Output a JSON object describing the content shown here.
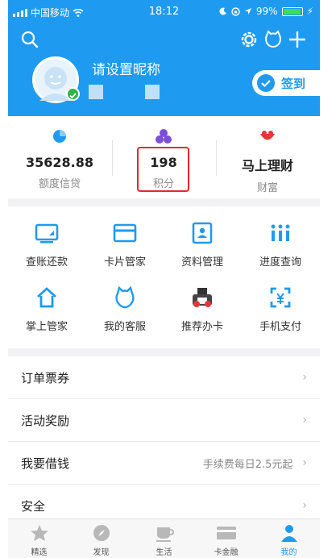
{
  "status_bar": {
    "carrier": "中国移动",
    "time": "18:12",
    "battery": "99%"
  },
  "profile": {
    "nickname": "请设置昵称",
    "signin_label": "签到"
  },
  "stats": [
    {
      "value": "35628.88",
      "label": "额度信贷"
    },
    {
      "value": "198",
      "label": "积分"
    },
    {
      "value": "马上理财",
      "label": "财富"
    }
  ],
  "grid": [
    {
      "label": "查账还款",
      "icon": "bill-icon"
    },
    {
      "label": "卡片管家",
      "icon": "card-icon"
    },
    {
      "label": "资料管理",
      "icon": "profile-doc-icon"
    },
    {
      "label": "进度查询",
      "icon": "progress-icon"
    },
    {
      "label": "掌上管家",
      "icon": "home-icon"
    },
    {
      "label": "我的客服",
      "icon": "customer-service-icon"
    },
    {
      "label": "推荐办卡",
      "icon": "recommend-card-icon"
    },
    {
      "label": "手机支付",
      "icon": "scan-pay-icon"
    }
  ],
  "list": [
    {
      "label": "订单票券",
      "hint": ""
    },
    {
      "label": "活动奖励",
      "hint": ""
    },
    {
      "label": "我要借钱",
      "hint": "手续费每日2.5元起"
    },
    {
      "label": "安全",
      "hint": ""
    }
  ],
  "tabs": [
    {
      "label": "精选",
      "icon": "star-icon"
    },
    {
      "label": "发现",
      "icon": "compass-icon"
    },
    {
      "label": "生活",
      "icon": "cup-icon"
    },
    {
      "label": "卡金融",
      "icon": "card-finance-icon"
    },
    {
      "label": "我的",
      "icon": "user-icon"
    }
  ],
  "active_tab": "我的",
  "colors": {
    "brand_blue": "#1e9bf0",
    "highlight_red": "#e8282a"
  }
}
